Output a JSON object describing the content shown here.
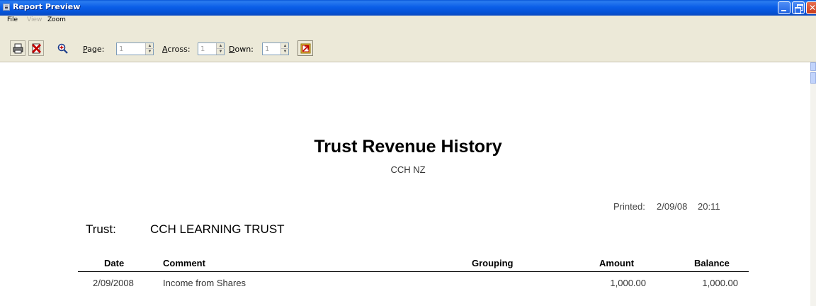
{
  "window": {
    "title": "Report Preview"
  },
  "menu": {
    "file": "File",
    "view": "View",
    "zoom": "Zoom"
  },
  "toolbar": {
    "icons": {
      "print": "print-icon",
      "close": "close-preview-icon",
      "zoom": "zoom-in-icon",
      "export": "export-icon"
    },
    "page_label_key": "P",
    "page_label_rest": "age:",
    "page_value": "1",
    "across_label_key": "A",
    "across_label_rest": "cross:",
    "across_value": "1",
    "down_label_key": "D",
    "down_label_rest": "own:",
    "down_value": "1"
  },
  "report": {
    "title": "Trust Revenue History",
    "subtitle": "CCH NZ",
    "printed_label": "Printed:",
    "printed_date": "2/09/08",
    "printed_time": "20:11",
    "trust_label": "Trust:",
    "trust_name": "CCH LEARNING TRUST",
    "columns": {
      "date": "Date",
      "comment": "Comment",
      "grouping": "Grouping",
      "amount": "Amount",
      "balance": "Balance"
    },
    "rows": [
      {
        "date": "2/09/2008",
        "comment": "Income from Shares",
        "grouping": "",
        "amount": "1,000.00",
        "balance": "1,000.00"
      }
    ]
  },
  "colors": {
    "titlebar": "#0b5ee8",
    "chrome": "#ece9d8"
  }
}
